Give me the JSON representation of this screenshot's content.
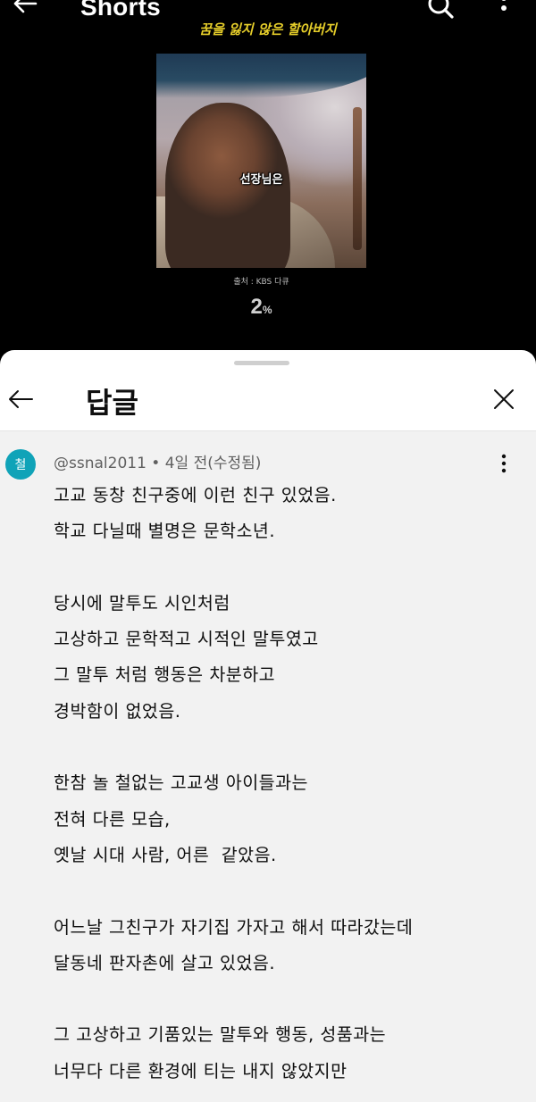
{
  "header": {
    "title": "Shorts",
    "icons": {
      "back": "back-arrow-icon",
      "search": "search-icon",
      "more": "more-vert-icon"
    }
  },
  "video": {
    "title": "꿈을 잃지 않은 할아버지",
    "subtitle": "선장님은",
    "source": "출처 : KBS 다큐",
    "progress_value": "2",
    "progress_symbol": "%"
  },
  "sheet": {
    "title": "답글",
    "icons": {
      "back": "back-arrow-icon",
      "close": "close-icon"
    }
  },
  "comment": {
    "avatar_letter": "철",
    "avatar_color": "#10a3b8",
    "meta": "@ssnal2011 • 4일 전(수정됨)",
    "lines": [
      "고교 동창 친구중에 이런 친구 있었음.",
      "학교 다닐때 별명은 문학소년.",
      "",
      "당시에 말투도 시인처럼",
      "고상하고 문학적고 시적인 말투였고",
      "그 말투 처럼 행동은 차분하고",
      "경박함이 없었음.",
      "",
      "한참 놀 철없는 고교생 아이들과는",
      "전혀 다른 모습,",
      "옛날 시대 사람, 어른  같았음.",
      "",
      "어느날 그친구가 자기집 가자고 해서 따라갔는데",
      "달동네 판자촌에 살고 있었음.",
      "",
      "그 고상하고 기품있는 말투와 행동, 성품과는",
      "너무다 다른 환경에 티는 내지 않았지만"
    ]
  }
}
